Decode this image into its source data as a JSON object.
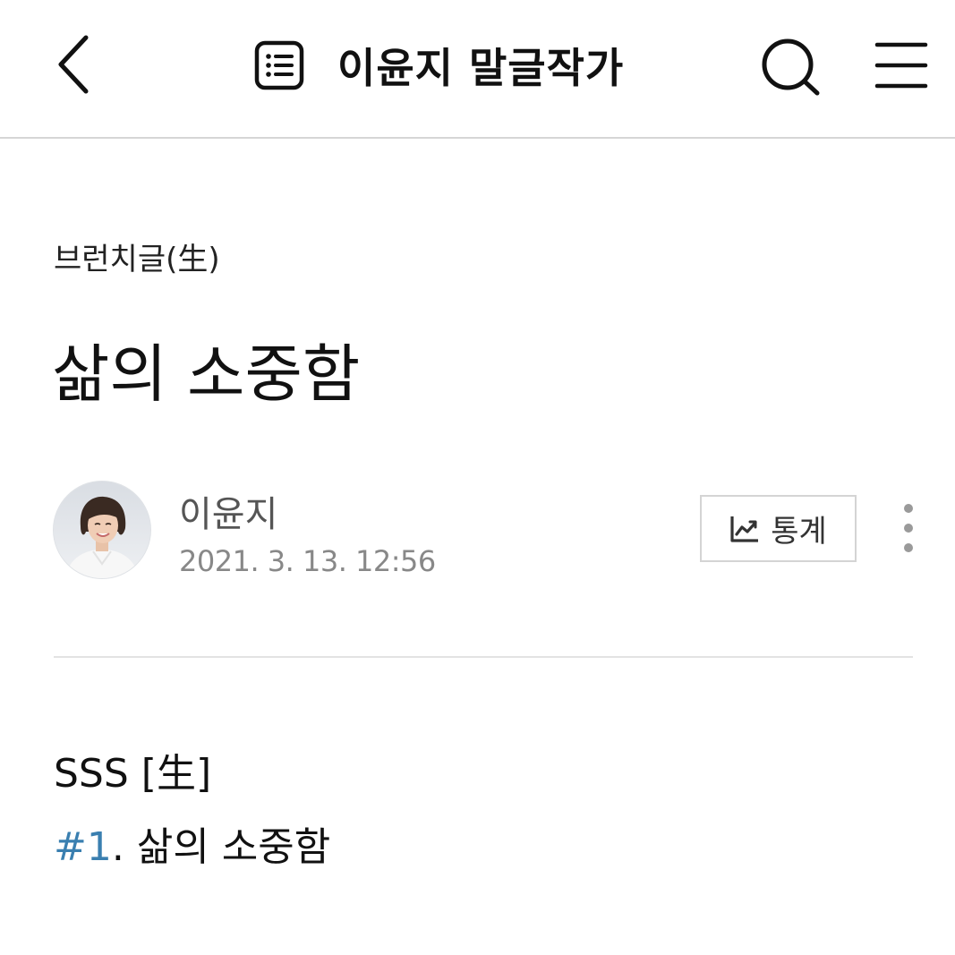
{
  "header": {
    "magazine_title": "이윤지 말글작가",
    "icons": {
      "back": "chevron-left-icon",
      "list": "list-icon",
      "search": "search-icon",
      "menu": "hamburger-menu-icon"
    }
  },
  "article": {
    "category": "브런치글(生)",
    "title": "삶의 소중함",
    "author": {
      "name": "이윤지",
      "date": "2021. 3. 13. 12:56"
    },
    "stats_button": {
      "label": "통계",
      "icon": "trend-chart-icon"
    },
    "more_icon": "vertical-dots-icon",
    "body": {
      "series_label": "SSS [生]",
      "episode_hashtag": "#1",
      "episode_text": ". 삶의 소중함"
    }
  },
  "colors": {
    "text": "#111111",
    "muted": "#888888",
    "link": "#3a7fb0",
    "divider": "#e3e3e3"
  }
}
